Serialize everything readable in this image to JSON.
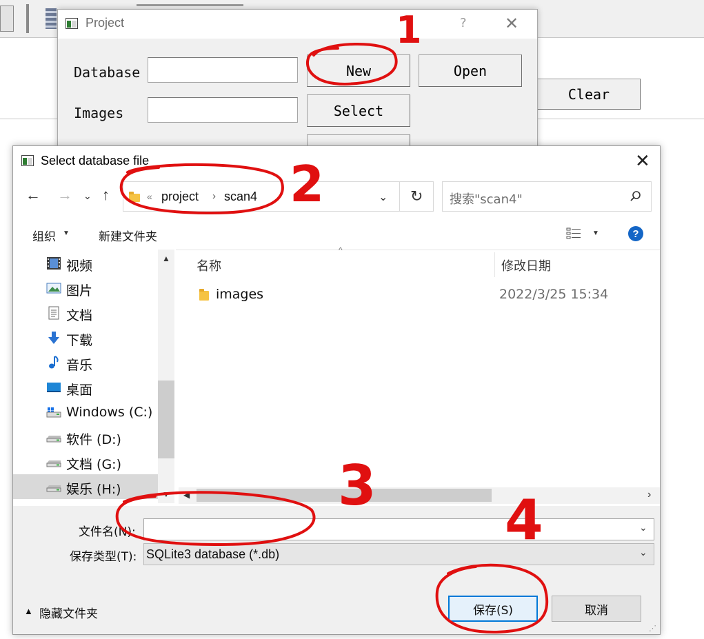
{
  "background_app": {
    "clear_label": "Clear"
  },
  "project_dialog": {
    "title": "Project",
    "help": "?",
    "close": "✕",
    "database_label": "Database",
    "images_label": "Images",
    "database_value": "",
    "images_value": "",
    "new_label": "New",
    "open_label": "Open",
    "select_label": "Select"
  },
  "file_dialog": {
    "title": "Select database file",
    "close": "✕",
    "breadcrumb": [
      "project",
      "scan4"
    ],
    "breadcrumb_overflow": "«",
    "search_placeholder": "搜索\"scan4\"",
    "toolbar": {
      "organize": "组织",
      "new_folder": "新建文件夹"
    },
    "nav_items": [
      {
        "label": "视频",
        "icon": "video-icon"
      },
      {
        "label": "图片",
        "icon": "pictures-icon"
      },
      {
        "label": "文档",
        "icon": "documents-icon"
      },
      {
        "label": "下载",
        "icon": "download-icon"
      },
      {
        "label": "音乐",
        "icon": "music-icon"
      },
      {
        "label": "桌面",
        "icon": "desktop-icon"
      },
      {
        "label": "Windows (C:)",
        "icon": "windows-drive-icon"
      },
      {
        "label": "软件 (D:)",
        "icon": "drive-icon"
      },
      {
        "label": "文档 (G:)",
        "icon": "drive-icon"
      },
      {
        "label": "娱乐 (H:)",
        "icon": "drive-icon"
      }
    ],
    "columns": {
      "name": "名称",
      "date": "修改日期"
    },
    "files": [
      {
        "name": "images",
        "date": "2022/3/25 15:34"
      }
    ],
    "filename_label": "文件名(N):",
    "filename_value": "",
    "filetype_label": "保存类型(T):",
    "filetype_value": "SQLite3 database (*.db)",
    "hide_folders": "隐藏文件夹",
    "save_label": "保存(S)",
    "cancel_label": "取消"
  },
  "annotations": [
    "1",
    "2",
    "3",
    "4"
  ],
  "colors": {
    "annotation": "#e01010",
    "accent": "#0078d7",
    "help_icon": "#1466c6"
  }
}
